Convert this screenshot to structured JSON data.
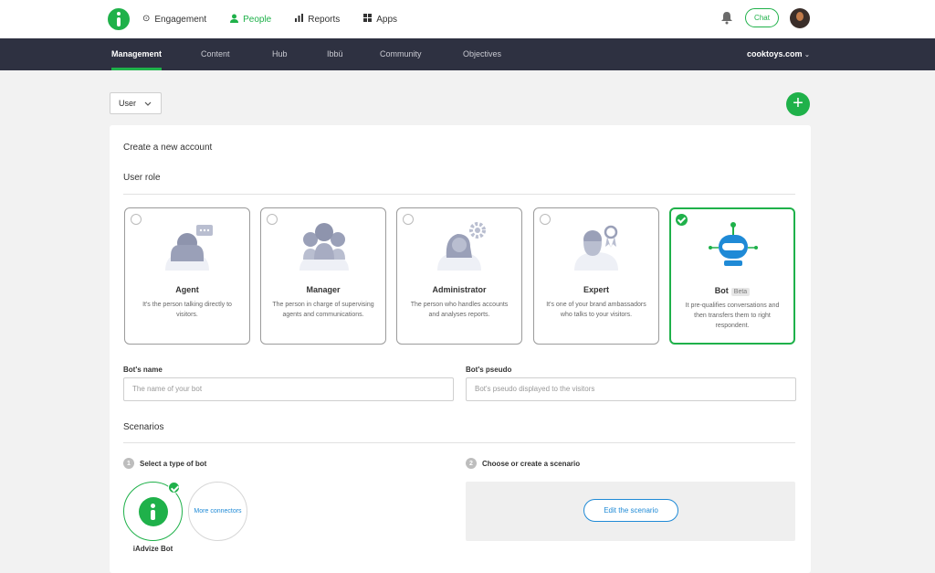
{
  "topnav": {
    "items": [
      {
        "icon": "target-icon",
        "label": "Engagement"
      },
      {
        "icon": "person-icon",
        "label": "People"
      },
      {
        "icon": "bar-chart-icon",
        "label": "Reports"
      },
      {
        "icon": "grid-icon",
        "label": "Apps"
      }
    ],
    "chat_label": "Chat"
  },
  "subnav": {
    "tabs": [
      "Management",
      "Content",
      "Hub",
      "Ibbü",
      "Community",
      "Objectives"
    ],
    "domain": "cooktoys.com"
  },
  "toolbar": {
    "select_value": "User",
    "add_label": "+"
  },
  "form": {
    "title": "Create a new account",
    "user_role_heading": "User role",
    "roles": [
      {
        "title": "Agent",
        "desc": "It's the person talking directly to visitors."
      },
      {
        "title": "Manager",
        "desc": "The person in charge of supervising agents and communications."
      },
      {
        "title": "Administrator",
        "desc": "The person who handles accounts and analyses reports."
      },
      {
        "title": "Expert",
        "desc": "It's one of your brand ambassadors who talks to your visitors."
      },
      {
        "title": "Bot",
        "badge": "Beta",
        "desc": "It pre-qualifies conversations and then transfers them to right respondent."
      }
    ],
    "selected_role": "Bot",
    "bot_name_label": "Bot's name",
    "bot_name_placeholder": "The name of your bot",
    "bot_pseudo_label": "Bot's pseudo",
    "bot_pseudo_placeholder": "Bot's pseudo displayed to the visitors",
    "scenarios_heading": "Scenarios",
    "step1_num": "1",
    "step1_label": "Select a type of bot",
    "step2_num": "2",
    "step2_label": "Choose or create a scenario",
    "bot_type_label": "iAdvize Bot",
    "more_connectors": "More connectors",
    "edit_scenario": "Edit the scenario"
  },
  "colors": {
    "accent": "#1fb14a",
    "link": "#1f8ad6",
    "subnav_bg": "#2e3141"
  }
}
